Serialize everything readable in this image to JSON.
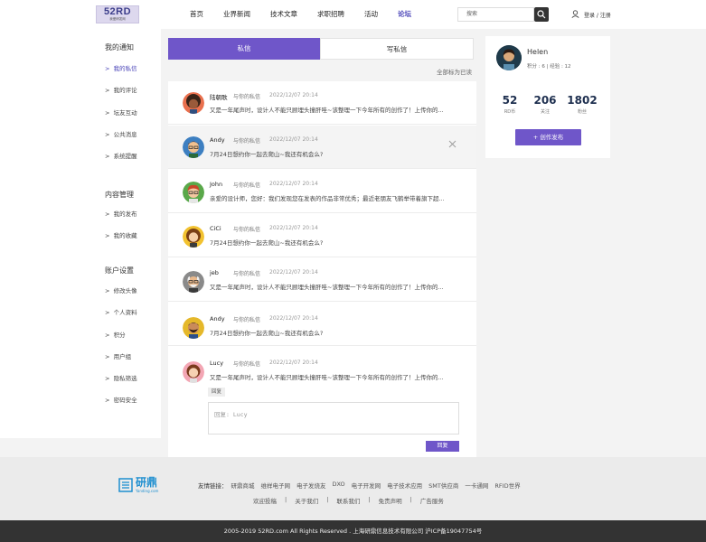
{
  "header": {
    "logo_text": "52RD",
    "logo_sub": "我爱研发网",
    "nav": [
      "首页",
      "业界新闻",
      "技术文章",
      "求职招聘",
      "活动",
      "论坛"
    ],
    "active_nav": "论坛",
    "search_placeholder": "搜索",
    "login_text": "登录 / 注册"
  },
  "sidebar": {
    "sections": [
      {
        "title": "我的通知",
        "items": [
          "我的私信",
          "我的评论",
          "坛友互动",
          "公共消息",
          "系统提醒"
        ]
      },
      {
        "title": "内容管理",
        "items": [
          "我的发布",
          "我的收藏"
        ]
      },
      {
        "title": "账户设置",
        "items": [
          "修改头像",
          "个人资料",
          "积分",
          "用户组",
          "隐私筛选",
          "密码安全"
        ]
      }
    ],
    "active_item": "我的私信",
    "bullet": ">"
  },
  "tabs": [
    "私信",
    "写私信"
  ],
  "mark_all_read": "全部标为已读",
  "messages": [
    {
      "name": "陆朝歌",
      "sub": "与你的私信",
      "time": "2022/12/07  20:14",
      "text": "又是一年尾声时，设计人不能只顾埋头撞肝哇~该整理一下今年所有的创作了！上传你的...",
      "avatar": "afro"
    },
    {
      "name": "Andy",
      "sub": "与你的私信",
      "time": "2022/12/07  20:14",
      "text": "7月24日想约你一起去爬山~我还有机会么?",
      "avatar": "glasses-man",
      "highlighted": true
    },
    {
      "name": "John",
      "sub": "与你的私信",
      "time": "2022/12/07  20:14",
      "text": "亲爱的设计师，您好：我们发现您在发表的作品非常优秀；最近老朋友飞鹤举带着旗下超...",
      "avatar": "red-hair"
    },
    {
      "name": "CiCi",
      "sub": "与你的私信",
      "time": "2022/12/07  20:14",
      "text": "7月24日想约你一起去爬山~我还有机会么?",
      "avatar": "curly-woman"
    },
    {
      "name": "jeb",
      "sub": "与你的私信",
      "time": "2022/12/07  20:14",
      "text": "又是一年尾声时，设计人不能只顾埋头撞肝哇~该整理一下今年所有的创作了！上传你的...",
      "avatar": "old-man"
    },
    {
      "name": "Andy",
      "sub": "与你的私信",
      "time": "2022/12/07  20:14",
      "text": "7月24日想约你一起去爬山~我还有机会么?",
      "avatar": "beard-man"
    },
    {
      "name": "Lucy",
      "sub": "与你的私信",
      "time": "2022/12/07  20:14",
      "text": "又是一年尾声时，设计人不能只顾埋头撞肝哇~该整理一下今年所有的创作了！上传你的...",
      "avatar": "pink-woman"
    }
  ],
  "reply": {
    "tag": "回复",
    "placeholder": "回复: Lucy",
    "button": "回复"
  },
  "profile": {
    "name": "Helen",
    "meta": "积分 : 6   |   经验 : 12",
    "stats": [
      {
        "value": "52",
        "label": "RD币"
      },
      {
        "value": "206",
        "label": "关注"
      },
      {
        "value": "1802",
        "label": "粉丝"
      }
    ],
    "create_button": "+  创作发布"
  },
  "footer": {
    "logo_cn": "研鼎",
    "logo_en": "Yanding.com",
    "links_label": "友情链接：",
    "links": [
      "研鼎商城",
      "维样电子网",
      "电子发烧友",
      "DXO",
      "电子开发网",
      "电子技术应用",
      "SMT供应商",
      "一卡通网",
      "RFID世界"
    ],
    "bottom_links": [
      "欢迎投稿",
      "关于我们",
      "联系我们",
      "免责声明",
      "广告服务"
    ],
    "separator": "|",
    "copyright": "2005-2019 52RD.com  All Rights Reserved . 上海研鼎信息技术有限公司 沪ICP备19047754号"
  },
  "colors": {
    "accent": "#6f56c9",
    "active_text": "#4a44b8",
    "dark_bar": "#333333"
  }
}
